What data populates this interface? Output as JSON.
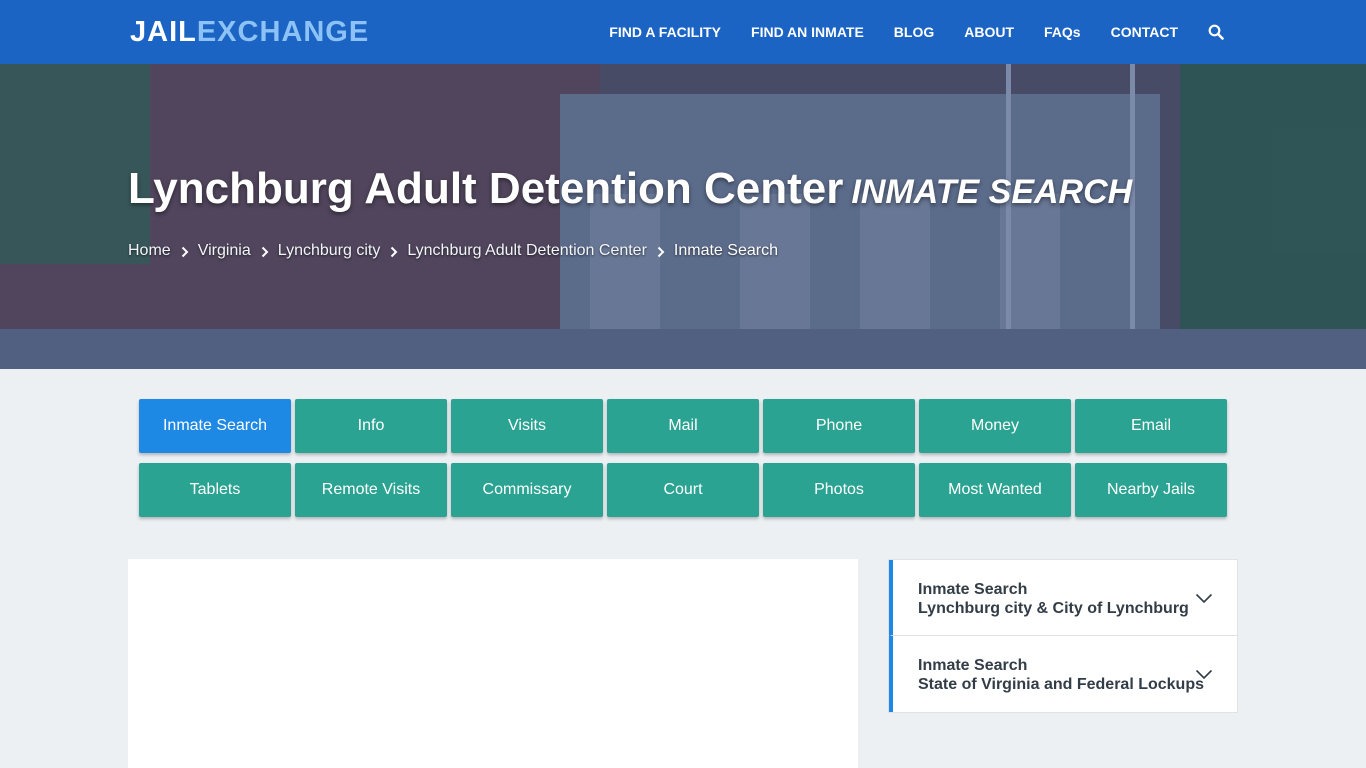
{
  "brand": {
    "part1": "JAIL",
    "part2": "EXCHANGE"
  },
  "nav": {
    "items": [
      "FIND A FACILITY",
      "FIND AN INMATE",
      "BLOG",
      "ABOUT",
      "FAQs",
      "CONTACT"
    ],
    "search_icon": "search-icon"
  },
  "hero": {
    "title": "Lynchburg Adult Detention Center",
    "subtitle": "Inmate Search",
    "breadcrumb": [
      "Home",
      "Virginia",
      "Lynchburg city",
      "Lynchburg Adult Detention Center",
      "Inmate Search"
    ]
  },
  "buttons": {
    "row1": [
      "Inmate Search",
      "Info",
      "Visits",
      "Mail",
      "Phone",
      "Money",
      "Email"
    ],
    "row2": [
      "Tablets",
      "Remote Visits",
      "Commissary",
      "Court",
      "Photos",
      "Most Wanted",
      "Nearby Jails"
    ]
  },
  "sidebar": {
    "items": [
      {
        "line1": "Inmate Search",
        "line2": "Lynchburg city & City of Lynchburg"
      },
      {
        "line1": "Inmate Search",
        "line2": "State of Virginia and Federal Lockups"
      }
    ]
  },
  "colors": {
    "navbar": "#1c64c4",
    "button": "#2aa392",
    "button_active": "#1e88e5",
    "page_bg": "#ecf0f3"
  }
}
